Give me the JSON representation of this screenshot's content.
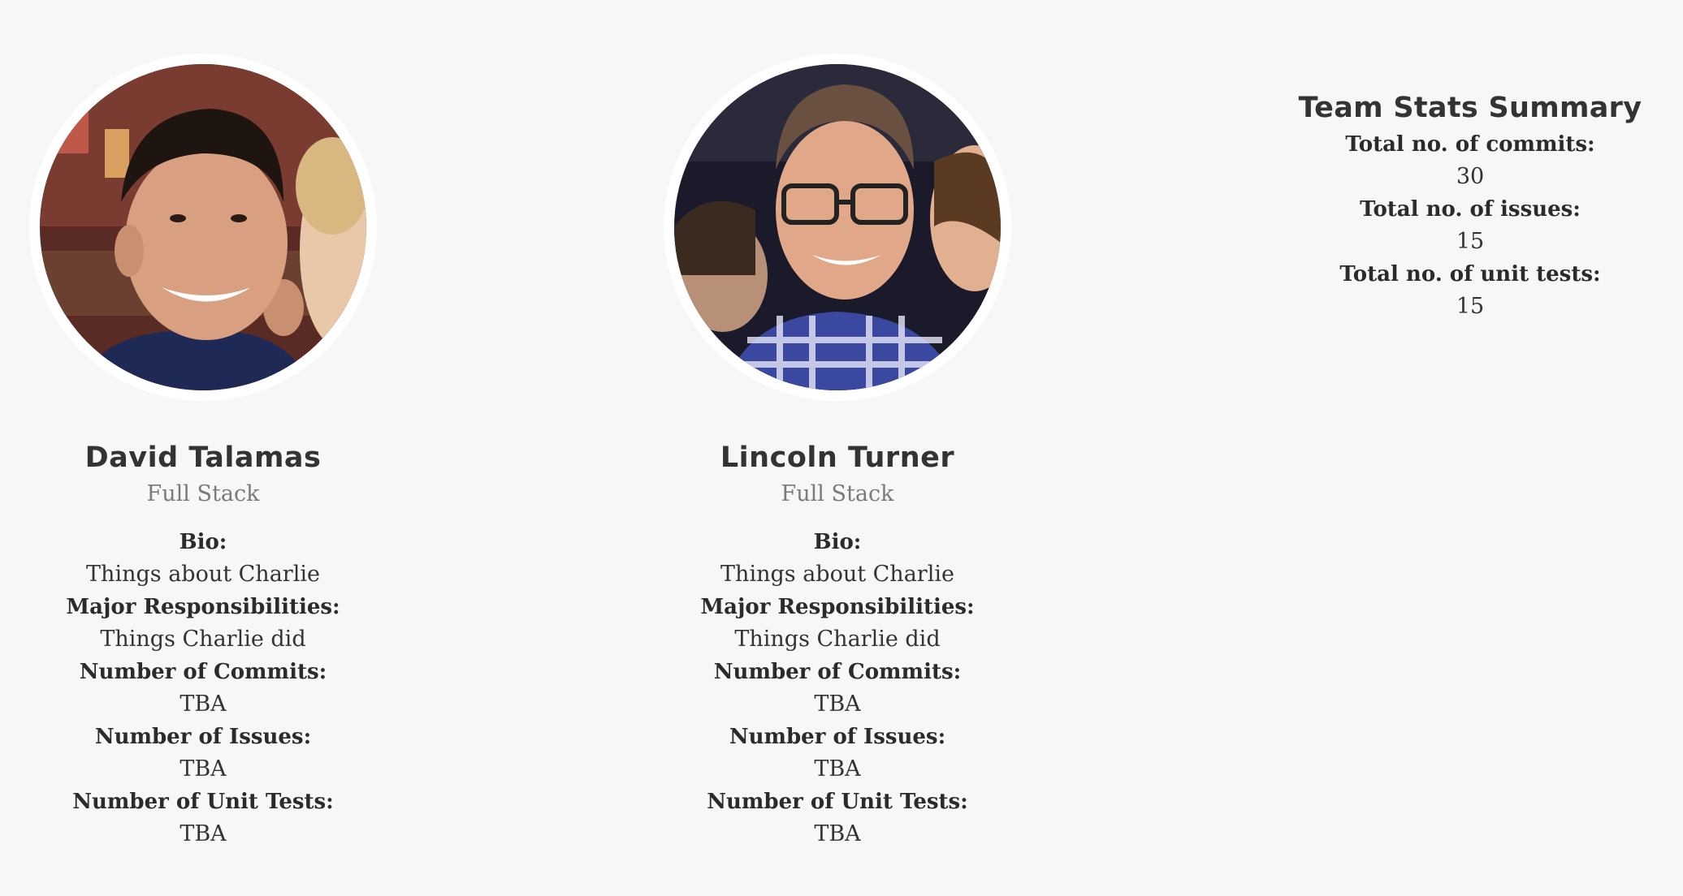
{
  "members": [
    {
      "name": "David Talamas",
      "role": "Full Stack",
      "bio_label": "Bio:",
      "bio": "Things about Charlie",
      "responsibilities_label": "Major Responsibilities:",
      "responsibilities": "Things Charlie did",
      "commits_label": "Number of Commits:",
      "commits": "TBA",
      "issues_label": "Number of Issues:",
      "issues": "TBA",
      "tests_label": "Number of Unit Tests:",
      "tests": "TBA"
    },
    {
      "name": "Lincoln Turner",
      "role": "Full Stack",
      "bio_label": "Bio:",
      "bio": "Things about Charlie",
      "responsibilities_label": "Major Responsibilities:",
      "responsibilities": "Things Charlie did",
      "commits_label": "Number of Commits:",
      "commits": "TBA",
      "issues_label": "Number of Issues:",
      "issues": "TBA",
      "tests_label": "Number of Unit Tests:",
      "tests": "TBA"
    }
  ],
  "stats": {
    "title": "Team Stats Summary",
    "commits_label": "Total no. of commits:",
    "commits": "30",
    "issues_label": "Total no. of issues:",
    "issues": "15",
    "tests_label": "Total no. of unit tests:",
    "tests": "15"
  },
  "colors": {
    "background": "#f7f7f7",
    "text": "#333333",
    "role_text": "#7a7a7a",
    "avatar_ring": "#ffffff"
  }
}
